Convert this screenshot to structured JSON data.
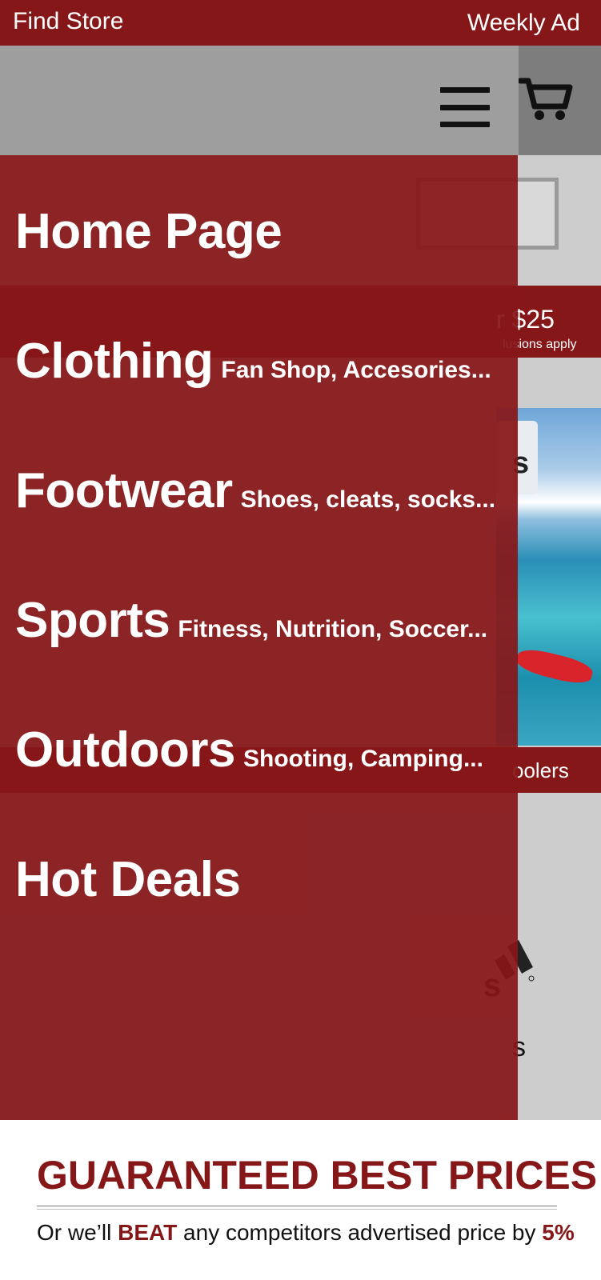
{
  "topbar": {
    "find_store": "Find Store",
    "weekly_ad": "Weekly Ad"
  },
  "header": {
    "menu_icon": "hamburger-menu-icon",
    "cart_icon": "shopping-cart-icon"
  },
  "promo": {
    "price": "$25",
    "partial_price": "r $25",
    "exclusions": "exclusions apply",
    "visible_exclusions": "lusions apply"
  },
  "hero": {
    "card_letter": "s"
  },
  "category_bar": {
    "partial": "oolers"
  },
  "brands": {
    "partial_adidas": "s"
  },
  "menu": {
    "items": [
      {
        "label": "Home Page",
        "sub": ""
      },
      {
        "label": "Clothing",
        "sub": "Fan Shop, Accesories..."
      },
      {
        "label": "Footwear",
        "sub": "Shoes, cleats, socks..."
      },
      {
        "label": "Sports",
        "sub": "Fitness, Nutrition, Soccer..."
      },
      {
        "label": "Outdoors",
        "sub": "Shooting, Camping..."
      },
      {
        "label": "Hot Deals",
        "sub": ""
      }
    ]
  },
  "footer": {
    "title": "GUARANTEED BEST PRICES",
    "line_prefix": "Or we’ll ",
    "line_beat": "BEAT",
    "line_middle": " any competitors advertised price by ",
    "line_percent": "5%"
  },
  "colors": {
    "brand_red": "#861719",
    "header_gray": "#9e9e9e"
  }
}
